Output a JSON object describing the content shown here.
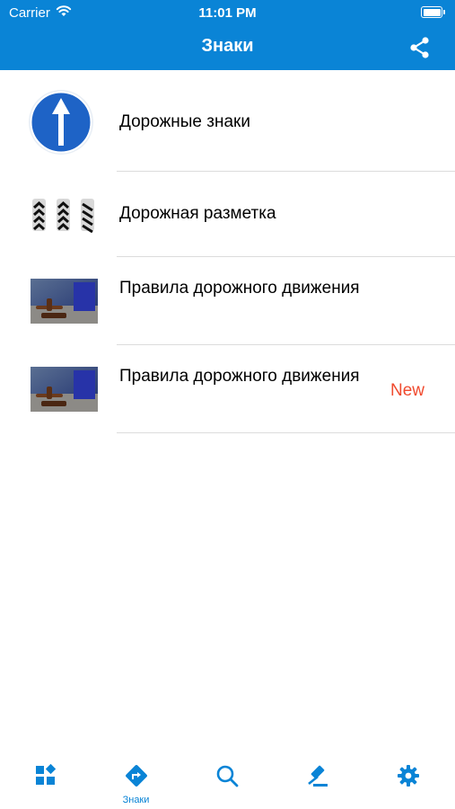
{
  "status_bar": {
    "carrier": "Carrier",
    "time": "11:01 PM"
  },
  "nav": {
    "title": "Знаки",
    "share_icon": "share-icon"
  },
  "list": {
    "items": [
      {
        "label": "Дорожные знаки",
        "icon": "straight-arrow-road-sign",
        "badge": ""
      },
      {
        "label": "Дорожная разметка",
        "icon": "road-marking-posts",
        "badge": ""
      },
      {
        "label": "Правила дорожного движения",
        "icon": "gavel-photo",
        "badge": ""
      },
      {
        "label": "Правила дорожного движения",
        "icon": "gavel-photo",
        "badge": "New"
      }
    ]
  },
  "tabbar": {
    "tabs": [
      {
        "icon": "dashboard-icon",
        "label": ""
      },
      {
        "icon": "turn-sign-icon",
        "label": "Знаки"
      },
      {
        "icon": "search-icon",
        "label": ""
      },
      {
        "icon": "gavel-icon",
        "label": ""
      },
      {
        "icon": "gear-icon",
        "label": ""
      }
    ],
    "active_index": 1
  },
  "colors": {
    "header_bg": "#0a84d6",
    "accent": "#0a84d6",
    "badge": "#f04a2e",
    "separator": "#dcdcdc"
  }
}
